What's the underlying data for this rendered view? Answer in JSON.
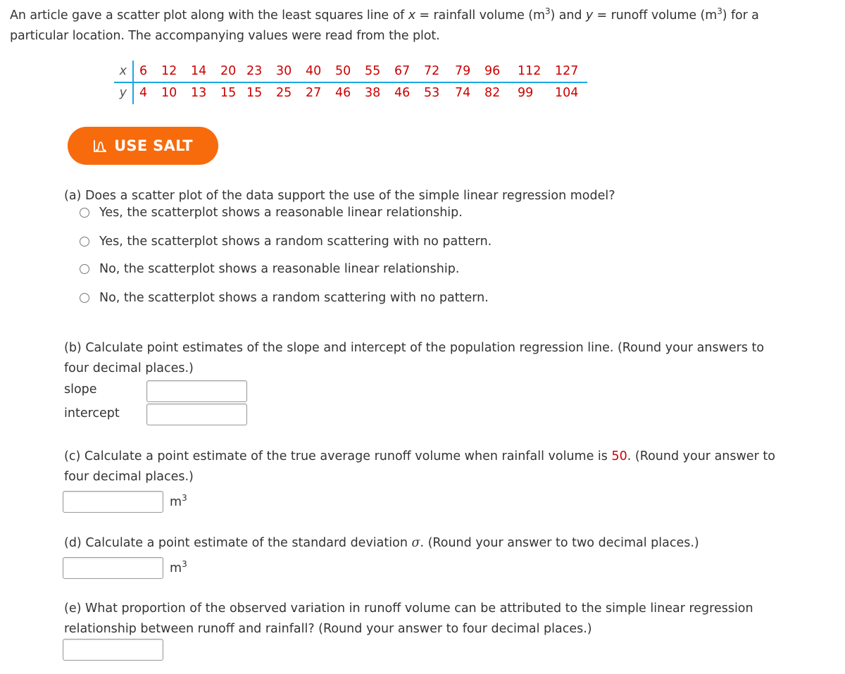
{
  "intro": {
    "part1": "An article gave a scatter plot along with the least squares line of ",
    "x_var": "x",
    "part2": " = rainfall volume (m",
    "exp": "3",
    "part3": ") and ",
    "y_var": "y",
    "part4": " = runoff volume (m",
    "part5": ") for a",
    "line2": "particular location. The accompanying values were read from the plot."
  },
  "table": {
    "x_label": "x",
    "y_label": "y",
    "x_values": [
      "6",
      "12",
      "14",
      "20",
      "23",
      "30",
      "40",
      "50",
      "55",
      "67",
      "72",
      "79",
      "96",
      "112",
      "127"
    ],
    "y_values": [
      "4",
      "10",
      "13",
      "15",
      "15",
      "25",
      "27",
      "46",
      "38",
      "46",
      "53",
      "74",
      "82",
      "99",
      "104"
    ]
  },
  "salt_button": {
    "label": "USE SALT",
    "icon": "distribution-curve-icon",
    "color": "#f76b0c"
  },
  "part_a": {
    "question": "(a) Does a scatter plot of the data support the use of the simple linear regression model?",
    "options": [
      "Yes, the scatterplot shows a reasonable linear relationship.",
      "Yes, the scatterplot shows a random scattering with no pattern.",
      "No, the scatterplot shows a reasonable linear relationship.",
      "No, the scatterplot shows a random scattering with no pattern."
    ]
  },
  "part_b": {
    "line1": "(b) Calculate point estimates of the slope and intercept of the population regression line. (Round your answers to",
    "line2": "four decimal places.)",
    "slope_label": "slope",
    "intercept_label": "intercept",
    "slope_value": "",
    "intercept_value": ""
  },
  "part_c": {
    "line1a": "(c) Calculate a point estimate of the true average runoff volume when rainfall volume is ",
    "highlight": "50",
    "line1b": ". (Round your answer to",
    "line2": "four decimal places.)",
    "unit": "m",
    "unit_exp": "3",
    "value": ""
  },
  "part_d": {
    "line1a": "(d) Calculate a point estimate of the standard deviation ",
    "sigma": "σ",
    "line1b": ". (Round your answer to two decimal places.)",
    "unit": "m",
    "unit_exp": "3",
    "value": ""
  },
  "part_e": {
    "line1": "(e) What proportion of the observed variation in runoff volume can be attributed to the simple linear regression",
    "line2": "relationship between runoff and rainfall? (Round your answer to four decimal places.)",
    "value": ""
  },
  "colors": {
    "accent_red": "#cc0000",
    "table_rule": "#1aa7e0",
    "salt_orange": "#f76b0c"
  }
}
